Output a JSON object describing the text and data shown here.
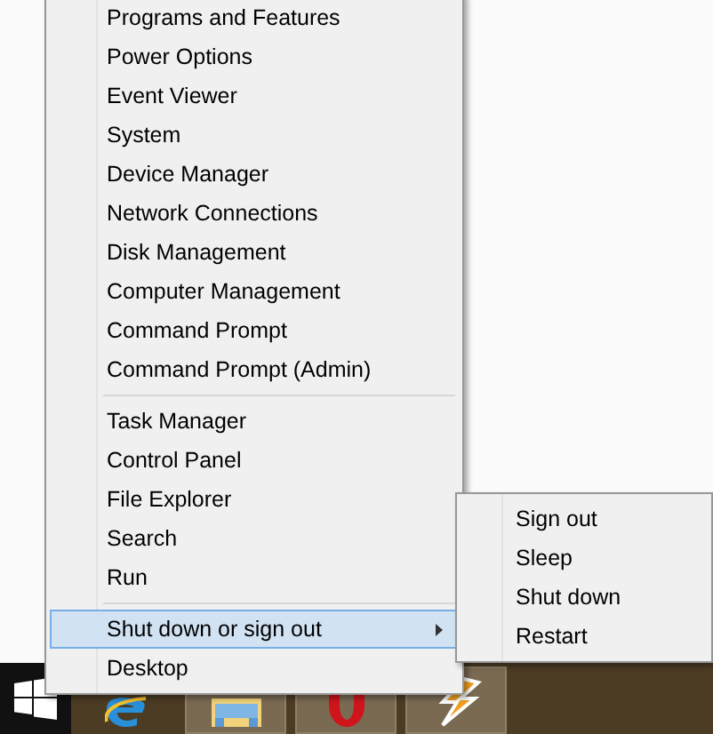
{
  "menu": {
    "groups": [
      {
        "items": [
          {
            "label": "Programs and Features",
            "selected": false,
            "submenu": false
          },
          {
            "label": "Power Options",
            "selected": false,
            "submenu": false
          },
          {
            "label": "Event Viewer",
            "selected": false,
            "submenu": false
          },
          {
            "label": "System",
            "selected": false,
            "submenu": false
          },
          {
            "label": "Device Manager",
            "selected": false,
            "submenu": false
          },
          {
            "label": "Network Connections",
            "selected": false,
            "submenu": false
          },
          {
            "label": "Disk Management",
            "selected": false,
            "submenu": false
          },
          {
            "label": "Computer Management",
            "selected": false,
            "submenu": false
          },
          {
            "label": "Command Prompt",
            "selected": false,
            "submenu": false
          },
          {
            "label": "Command Prompt (Admin)",
            "selected": false,
            "submenu": false
          }
        ]
      },
      {
        "items": [
          {
            "label": "Task Manager",
            "selected": false,
            "submenu": false
          },
          {
            "label": "Control Panel",
            "selected": false,
            "submenu": false
          },
          {
            "label": "File Explorer",
            "selected": false,
            "submenu": false
          },
          {
            "label": "Search",
            "selected": false,
            "submenu": false
          },
          {
            "label": "Run",
            "selected": false,
            "submenu": false
          }
        ]
      },
      {
        "items": [
          {
            "label": "Shut down or sign out",
            "selected": true,
            "submenu": true
          },
          {
            "label": "Desktop",
            "selected": false,
            "submenu": false
          }
        ]
      }
    ]
  },
  "submenu": {
    "items": [
      {
        "label": "Sign out",
        "selected": false
      },
      {
        "label": "Sleep",
        "selected": false
      },
      {
        "label": "Shut down",
        "selected": false
      },
      {
        "label": "Restart",
        "selected": false
      }
    ]
  }
}
